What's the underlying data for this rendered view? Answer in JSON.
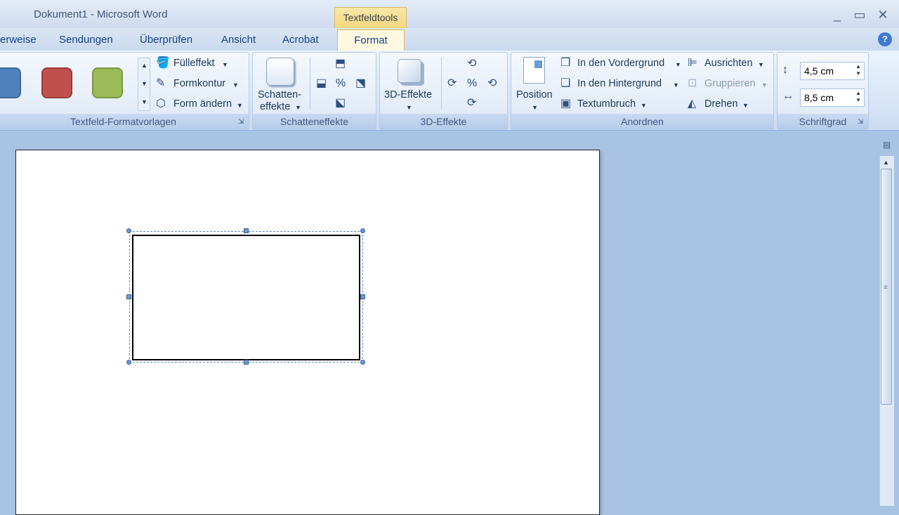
{
  "window": {
    "title": "Dokument1 - Microsoft Word",
    "context_tab": "Textfeldtools",
    "controls": [
      "_",
      "▭",
      "✕"
    ]
  },
  "tabs": [
    {
      "label": "erweise"
    },
    {
      "label": "Sendungen"
    },
    {
      "label": "Überprüfen"
    },
    {
      "label": "Ansicht"
    },
    {
      "label": "Acrobat"
    },
    {
      "label": "Format",
      "active": true
    }
  ],
  "help_label": "?",
  "ribbon": {
    "styles_group": {
      "title": "Textfeld-Formatvorlagen",
      "swatch_colors": [
        "#4f81bd",
        "#c0504d",
        "#9bbb59"
      ],
      "commands": [
        "Fülleffekt",
        "Formkontur",
        "Form ändern"
      ]
    },
    "shadow_group": {
      "title": "Schatteneffekte",
      "button_line1": "Schatten-",
      "button_line2": "effekte"
    },
    "effects3d_group": {
      "title": "3D-Effekte",
      "button_label": "3D-Effekte"
    },
    "arrange_group": {
      "title": "Anordnen",
      "position_label": "Position",
      "commands_left": [
        "In den Vordergrund",
        "In den Hintergrund",
        "Textumbruch"
      ],
      "commands_right": [
        "Ausrichten",
        "Gruppieren",
        "Drehen"
      ]
    },
    "size_group": {
      "title": "Schriftgrad",
      "height_value": "4,5 cm",
      "width_value": "8,5 cm"
    }
  },
  "colors": {
    "accent_tab": "#f5d77f",
    "ribbon_blue": "#c9daf2",
    "workspace": "#a9c3e2"
  }
}
